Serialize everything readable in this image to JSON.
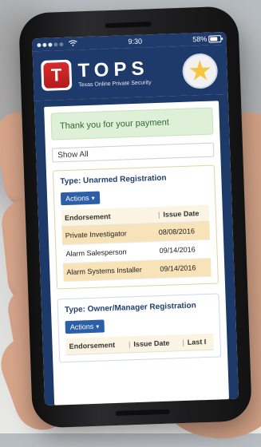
{
  "status_bar": {
    "time": "9:30",
    "battery": "58%"
  },
  "header": {
    "brand_initial": "T",
    "brand_title": "TOPS",
    "brand_subtitle": "Texas Online Private Security"
  },
  "main": {
    "success_message": "Thank you for your payment",
    "filter": {
      "value": "Show All"
    },
    "cards": [
      {
        "type_label": "Type: Unarmed Registration",
        "actions_label": "Actions",
        "columns": [
          "Endorsement",
          "Issue Date"
        ],
        "rows": [
          {
            "endorsement": "Private Investigator",
            "issue_date": "08/08/2016",
            "highlight": true
          },
          {
            "endorsement": "Alarm Salesperson",
            "issue_date": "09/14/2016",
            "highlight": false
          },
          {
            "endorsement": "Alarm Systems Installer",
            "issue_date": "09/14/2016",
            "highlight": true
          }
        ]
      },
      {
        "type_label": "Type: Owner/Manager Registration",
        "actions_label": "Actions",
        "columns": [
          "Endorsement",
          "Issue Date",
          "Last I"
        ],
        "rows": []
      }
    ]
  },
  "icons": {
    "signal": "signal-dots-icon",
    "wifi": "wifi-icon",
    "battery": "battery-icon",
    "seal": "state-seal-icon",
    "caret": "chevron-down-icon"
  },
  "colors": {
    "header_blue": "#1e3a6a",
    "success_bg": "#dff0d8",
    "highlight_row": "#f8e2b7",
    "brand_red": "#d72b2b",
    "action_blue": "#2c5fa8"
  }
}
